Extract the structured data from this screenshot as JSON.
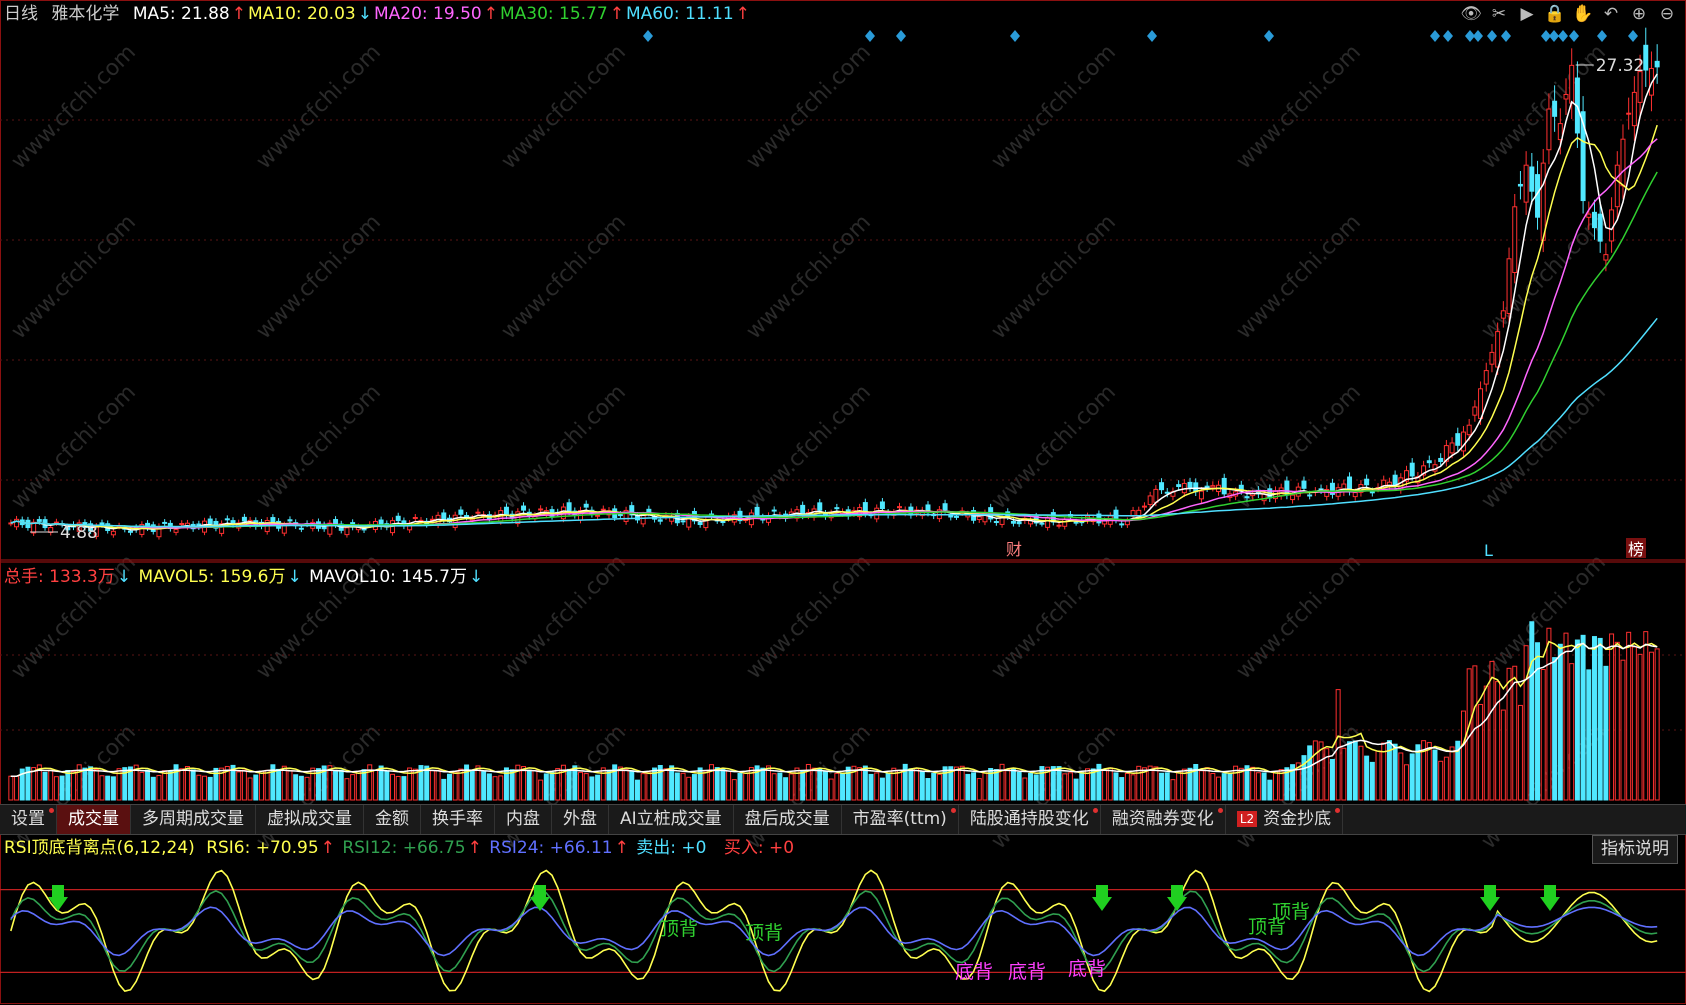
{
  "price_panel": {
    "period": "日线",
    "stock_name": "雅本化学",
    "ma_items": [
      {
        "label": "MA5: 21.88",
        "arrow": "↑",
        "color": "#ffffff"
      },
      {
        "label": "MA10: 20.03",
        "arrow": "↓",
        "color": "#ffff50"
      },
      {
        "label": "MA20: 19.50",
        "arrow": "↑",
        "color": "#ff66ff"
      },
      {
        "label": "MA30: 15.77",
        "arrow": "↑",
        "color": "#30d030"
      },
      {
        "label": "MA60: 11.11",
        "arrow": "↑",
        "color": "#50dfff"
      }
    ],
    "high_label": "27.32",
    "low_label": "4.88",
    "markers": {
      "cai": "财",
      "bang": "榜",
      "L": "L"
    }
  },
  "volume_panel": {
    "total_label": "总手: 133.3万",
    "total_arrow": "↓",
    "mavol5_label": "MAVOL5: 159.6万",
    "mavol5_arrow": "↓",
    "mavol10_label": "MAVOL10: 145.7万",
    "mavol10_arrow": "↓"
  },
  "tabs": [
    {
      "label": "设置",
      "dot": true,
      "active": false,
      "l2": false
    },
    {
      "label": "成交量",
      "dot": false,
      "active": true,
      "l2": false
    },
    {
      "label": "多周期成交量",
      "dot": false,
      "active": false,
      "l2": false
    },
    {
      "label": "虚拟成交量",
      "dot": false,
      "active": false,
      "l2": false
    },
    {
      "label": "金额",
      "dot": false,
      "active": false,
      "l2": false
    },
    {
      "label": "换手率",
      "dot": false,
      "active": false,
      "l2": false
    },
    {
      "label": "内盘",
      "dot": false,
      "active": false,
      "l2": false
    },
    {
      "label": "外盘",
      "dot": false,
      "active": false,
      "l2": false
    },
    {
      "label": "AI立桩成交量",
      "dot": false,
      "active": false,
      "l2": false
    },
    {
      "label": "盘后成交量",
      "dot": false,
      "active": false,
      "l2": false
    },
    {
      "label": "市盈率(ttm)",
      "dot": true,
      "active": false,
      "l2": false
    },
    {
      "label": "陆股通持股变化",
      "dot": true,
      "active": false,
      "l2": false
    },
    {
      "label": "融资融券变化",
      "dot": true,
      "active": false,
      "l2": false
    },
    {
      "label": "资金抄底",
      "dot": true,
      "active": false,
      "l2": true
    }
  ],
  "l2_badge": "L2",
  "rsi_panel": {
    "name": "RSI顶底背离点(6,12,24)",
    "rsi6_label": "RSI6: +70.95",
    "rsi6_arrow": "↑",
    "rsi12_label": "RSI12: +66.75",
    "rsi12_arrow": "↑",
    "rsi24_label": "RSI24: +66.11",
    "rsi24_arrow": "↑",
    "sell_label": "卖出: +0",
    "buy_label": "买入: +0",
    "explain_button": "指标说明",
    "top_div_label": "顶背",
    "bottom_div_label": "底背"
  },
  "watermark": "www.cfchi.com",
  "chart_data": [
    {
      "type": "candlestick",
      "title": "雅本化学 日线",
      "ylim": [
        4.0,
        29.0
      ],
      "max_price": 27.32,
      "min_price": 4.88,
      "bars": [
        {
          "x": 0,
          "o": 5.1,
          "c": 5.3
        },
        {
          "x": 20,
          "o": 5.2,
          "c": 5.0
        },
        {
          "x": 40,
          "o": 5.2,
          "c": 5.3
        },
        {
          "x": 60,
          "o": 5.0,
          "c": 5.1
        },
        {
          "x": 80,
          "o": 5.4,
          "c": 5.6
        },
        {
          "x": 100,
          "o": 5.5,
          "c": 5.9
        },
        {
          "x": 120,
          "o": 5.6,
          "c": 5.4
        },
        {
          "x": 140,
          "o": 5.7,
          "c": 5.8
        },
        {
          "x": 160,
          "o": 5.8,
          "c": 5.9
        },
        {
          "x": 180,
          "o": 5.2,
          "c": 5.3
        },
        {
          "x": 190,
          "o": 5.4,
          "c": 5.5
        },
        {
          "x": 196,
          "o": 5.6,
          "c": 5.4
        },
        {
          "x": 200,
          "o": 6.0,
          "c": 6.6
        },
        {
          "x": 202,
          "o": 6.4,
          "c": 6.9
        },
        {
          "x": 204,
          "o": 7.2,
          "c": 6.8
        },
        {
          "x": 206,
          "o": 6.9,
          "c": 7.2
        },
        {
          "x": 208,
          "o": 7.0,
          "c": 6.8
        },
        {
          "x": 210,
          "o": 6.9,
          "c": 7.0
        },
        {
          "x": 215,
          "o": 6.9,
          "c": 6.8
        },
        {
          "x": 219,
          "o": 6.8,
          "c": 6.7
        },
        {
          "x": 230,
          "o": 6.7,
          "c": 6.9
        },
        {
          "x": 240,
          "o": 6.8,
          "c": 7.0
        },
        {
          "x": 250,
          "o": 7.3,
          "c": 8.1
        },
        {
          "x": 256,
          "o": 9.0,
          "c": 10.0
        },
        {
          "x": 260,
          "o": 12.0,
          "c": 13.5
        },
        {
          "x": 262,
          "o": 14.5,
          "c": 15.5
        },
        {
          "x": 264,
          "o": 18.5,
          "c": 20.5
        },
        {
          "x": 266,
          "o": 21.0,
          "c": 22.5
        },
        {
          "x": 268,
          "o": 21.5,
          "c": 20.0
        },
        {
          "x": 270,
          "o": 22.0,
          "c": 25.2
        },
        {
          "x": 272,
          "o": 23.0,
          "c": 24.5
        },
        {
          "x": 274,
          "o": 24.0,
          "c": 27.3
        },
        {
          "x": 276,
          "o": 21.8,
          "c": 20.8
        },
        {
          "x": 278,
          "o": 20.5,
          "c": 19.5
        },
        {
          "x": 280,
          "o": 19.0,
          "c": 18.2
        },
        {
          "x": 282,
          "o": 20.0,
          "c": 22.5
        },
        {
          "x": 284,
          "o": 24.0,
          "c": 25.0
        },
        {
          "x": 286,
          "o": 24.5,
          "c": 27.0
        }
      ],
      "ma": [
        {
          "name": "MA5",
          "last": 21.88
        },
        {
          "name": "MA10",
          "last": 20.03
        },
        {
          "name": "MA20",
          "last": 19.5
        },
        {
          "name": "MA30",
          "last": 15.77
        },
        {
          "name": "MA60",
          "last": 11.11
        }
      ]
    },
    {
      "type": "bar",
      "title": "成交量",
      "unit": "万",
      "last_volume": 133.3,
      "mavol5_last": 159.6,
      "mavol10_last": 145.7
    },
    {
      "type": "line",
      "title": "RSI顶底背离点(6,12,24)",
      "ylim": [
        0,
        100
      ],
      "series": [
        {
          "name": "RSI6",
          "last": 70.95
        },
        {
          "name": "RSI12",
          "last": 66.75
        },
        {
          "name": "RSI24",
          "last": 66.11
        }
      ],
      "reference_lines": [
        80,
        20
      ]
    }
  ]
}
